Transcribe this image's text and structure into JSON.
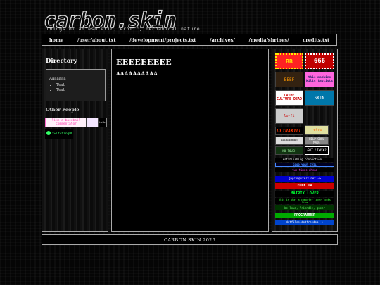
{
  "site": {
    "logo_text": "carbon.skin",
    "tagline": "things of an esoteric, erotic, mechanical nature"
  },
  "nav": {
    "items": [
      "home",
      "/user/about.txt",
      "/development/projects.txt",
      "/archives/",
      "/media/shrines/",
      "credits.txt"
    ]
  },
  "sidebar": {
    "title": "Directory",
    "box_heading": "Aaaaaaa",
    "box_items": [
      "Text",
      "Text"
    ],
    "other_title": "Other People",
    "buttons": [
      {
        "text": "like a baseball commentator",
        "color": "#ff66cc"
      },
      {
        "text": "cultofkirby",
        "color": "#ffffff"
      },
      {
        "text": "twitchingDM",
        "color": "#33ff66"
      }
    ]
  },
  "main": {
    "heading": "EEEEEEEEE",
    "paragraph": "AAAAAAAAAA"
  },
  "badges": [
    {
      "text": "BB",
      "bg": "#ff2222",
      "fg": "#ffee00"
    },
    {
      "text": "666",
      "bg": "#c00000",
      "fg": "#ffffff"
    },
    {
      "text": "BEEF",
      "bg": "#332211",
      "fg": "#ff9900"
    },
    {
      "text": "this machine kills fascists",
      "bg": "#ff66dd",
      "fg": "#222266"
    },
    {
      "text": "CRIME CULTURE DEAD",
      "bg": "#ffffff",
      "fg": "#cc0000"
    },
    {
      "text": "SKIN",
      "bg": "#0077aa",
      "fg": "#ffffff"
    },
    {
      "text": "lo-fi",
      "bg": "#cccccc",
      "fg": "#cc0000"
    },
    {
      "text": "ULTRAKILL",
      "bg": "#000000",
      "fg": "#ff3300"
    },
    {
      "text": "retro",
      "bg": "#e0e0a0",
      "fg": "#ff6600"
    },
    {
      "text": "000000001",
      "bg": "#dddddd",
      "fg": "#000000"
    },
    {
      "text": "HELP SOUL MADE",
      "bg": "#888888",
      "fg": "#ffffff"
    },
    {
      "text": "NO TOUCH",
      "bg": "#113311",
      "fg": "#aaffaa"
    },
    {
      "text": "GOT LINUX?",
      "bg": "#000000",
      "fg": "#ffffff"
    }
  ],
  "stamps": [
    {
      "text": "establishing connection...",
      "bg": "#000000",
      "fg": "#ffffff"
    },
    {
      "text": "GOOD YOUR EVIL",
      "bg": "#000022",
      "fg": "#4488ff"
    },
    {
      "text": "fun times ahead",
      "bg": "#000000",
      "fg": "#ff44ff"
    },
    {
      "text": "gaycomputers.net ->",
      "bg": "#0000cc",
      "fg": "#ffffff"
    },
    {
      "text": "FUCK UR",
      "bg": "#cc0000",
      "fg": "#ffffff"
    },
    {
      "text": "MATRIX LOVER",
      "bg": "#000000",
      "fg": "#00ff33"
    },
    {
      "text": "this is what a computer lover looks like",
      "bg": "#000000",
      "fg": "#33ff33"
    },
    {
      "text": "be loud, friendly, queer",
      "bg": "#003300",
      "fg": "#66ff66"
    },
    {
      "text": "PROGRAMMER",
      "bg": "#00aa00",
      "fg": "#ffffff"
    },
    {
      "text": "dotfiles.dotfreedom ->",
      "bg": "#0044cc",
      "fg": "#ffffff"
    }
  ],
  "footer": {
    "text": "CARBON.SKIN 2026"
  }
}
